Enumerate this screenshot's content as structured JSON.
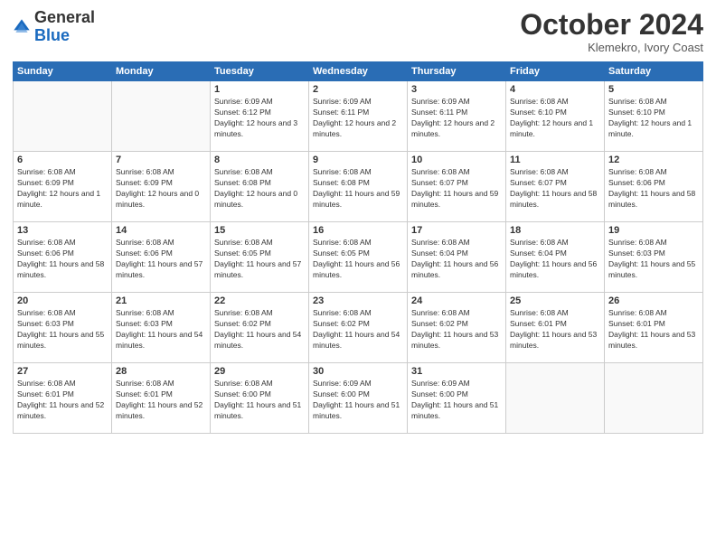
{
  "header": {
    "logo_general": "General",
    "logo_blue": "Blue",
    "month": "October 2024",
    "location": "Klemekro, Ivory Coast"
  },
  "weekdays": [
    "Sunday",
    "Monday",
    "Tuesday",
    "Wednesday",
    "Thursday",
    "Friday",
    "Saturday"
  ],
  "weeks": [
    [
      {
        "day": "",
        "info": ""
      },
      {
        "day": "",
        "info": ""
      },
      {
        "day": "1",
        "info": "Sunrise: 6:09 AM\nSunset: 6:12 PM\nDaylight: 12 hours and 3 minutes."
      },
      {
        "day": "2",
        "info": "Sunrise: 6:09 AM\nSunset: 6:11 PM\nDaylight: 12 hours and 2 minutes."
      },
      {
        "day": "3",
        "info": "Sunrise: 6:09 AM\nSunset: 6:11 PM\nDaylight: 12 hours and 2 minutes."
      },
      {
        "day": "4",
        "info": "Sunrise: 6:08 AM\nSunset: 6:10 PM\nDaylight: 12 hours and 1 minute."
      },
      {
        "day": "5",
        "info": "Sunrise: 6:08 AM\nSunset: 6:10 PM\nDaylight: 12 hours and 1 minute."
      }
    ],
    [
      {
        "day": "6",
        "info": "Sunrise: 6:08 AM\nSunset: 6:09 PM\nDaylight: 12 hours and 1 minute."
      },
      {
        "day": "7",
        "info": "Sunrise: 6:08 AM\nSunset: 6:09 PM\nDaylight: 12 hours and 0 minutes."
      },
      {
        "day": "8",
        "info": "Sunrise: 6:08 AM\nSunset: 6:08 PM\nDaylight: 12 hours and 0 minutes."
      },
      {
        "day": "9",
        "info": "Sunrise: 6:08 AM\nSunset: 6:08 PM\nDaylight: 11 hours and 59 minutes."
      },
      {
        "day": "10",
        "info": "Sunrise: 6:08 AM\nSunset: 6:07 PM\nDaylight: 11 hours and 59 minutes."
      },
      {
        "day": "11",
        "info": "Sunrise: 6:08 AM\nSunset: 6:07 PM\nDaylight: 11 hours and 58 minutes."
      },
      {
        "day": "12",
        "info": "Sunrise: 6:08 AM\nSunset: 6:06 PM\nDaylight: 11 hours and 58 minutes."
      }
    ],
    [
      {
        "day": "13",
        "info": "Sunrise: 6:08 AM\nSunset: 6:06 PM\nDaylight: 11 hours and 58 minutes."
      },
      {
        "day": "14",
        "info": "Sunrise: 6:08 AM\nSunset: 6:06 PM\nDaylight: 11 hours and 57 minutes."
      },
      {
        "day": "15",
        "info": "Sunrise: 6:08 AM\nSunset: 6:05 PM\nDaylight: 11 hours and 57 minutes."
      },
      {
        "day": "16",
        "info": "Sunrise: 6:08 AM\nSunset: 6:05 PM\nDaylight: 11 hours and 56 minutes."
      },
      {
        "day": "17",
        "info": "Sunrise: 6:08 AM\nSunset: 6:04 PM\nDaylight: 11 hours and 56 minutes."
      },
      {
        "day": "18",
        "info": "Sunrise: 6:08 AM\nSunset: 6:04 PM\nDaylight: 11 hours and 56 minutes."
      },
      {
        "day": "19",
        "info": "Sunrise: 6:08 AM\nSunset: 6:03 PM\nDaylight: 11 hours and 55 minutes."
      }
    ],
    [
      {
        "day": "20",
        "info": "Sunrise: 6:08 AM\nSunset: 6:03 PM\nDaylight: 11 hours and 55 minutes."
      },
      {
        "day": "21",
        "info": "Sunrise: 6:08 AM\nSunset: 6:03 PM\nDaylight: 11 hours and 54 minutes."
      },
      {
        "day": "22",
        "info": "Sunrise: 6:08 AM\nSunset: 6:02 PM\nDaylight: 11 hours and 54 minutes."
      },
      {
        "day": "23",
        "info": "Sunrise: 6:08 AM\nSunset: 6:02 PM\nDaylight: 11 hours and 54 minutes."
      },
      {
        "day": "24",
        "info": "Sunrise: 6:08 AM\nSunset: 6:02 PM\nDaylight: 11 hours and 53 minutes."
      },
      {
        "day": "25",
        "info": "Sunrise: 6:08 AM\nSunset: 6:01 PM\nDaylight: 11 hours and 53 minutes."
      },
      {
        "day": "26",
        "info": "Sunrise: 6:08 AM\nSunset: 6:01 PM\nDaylight: 11 hours and 53 minutes."
      }
    ],
    [
      {
        "day": "27",
        "info": "Sunrise: 6:08 AM\nSunset: 6:01 PM\nDaylight: 11 hours and 52 minutes."
      },
      {
        "day": "28",
        "info": "Sunrise: 6:08 AM\nSunset: 6:01 PM\nDaylight: 11 hours and 52 minutes."
      },
      {
        "day": "29",
        "info": "Sunrise: 6:08 AM\nSunset: 6:00 PM\nDaylight: 11 hours and 51 minutes."
      },
      {
        "day": "30",
        "info": "Sunrise: 6:09 AM\nSunset: 6:00 PM\nDaylight: 11 hours and 51 minutes."
      },
      {
        "day": "31",
        "info": "Sunrise: 6:09 AM\nSunset: 6:00 PM\nDaylight: 11 hours and 51 minutes."
      },
      {
        "day": "",
        "info": ""
      },
      {
        "day": "",
        "info": ""
      }
    ]
  ]
}
